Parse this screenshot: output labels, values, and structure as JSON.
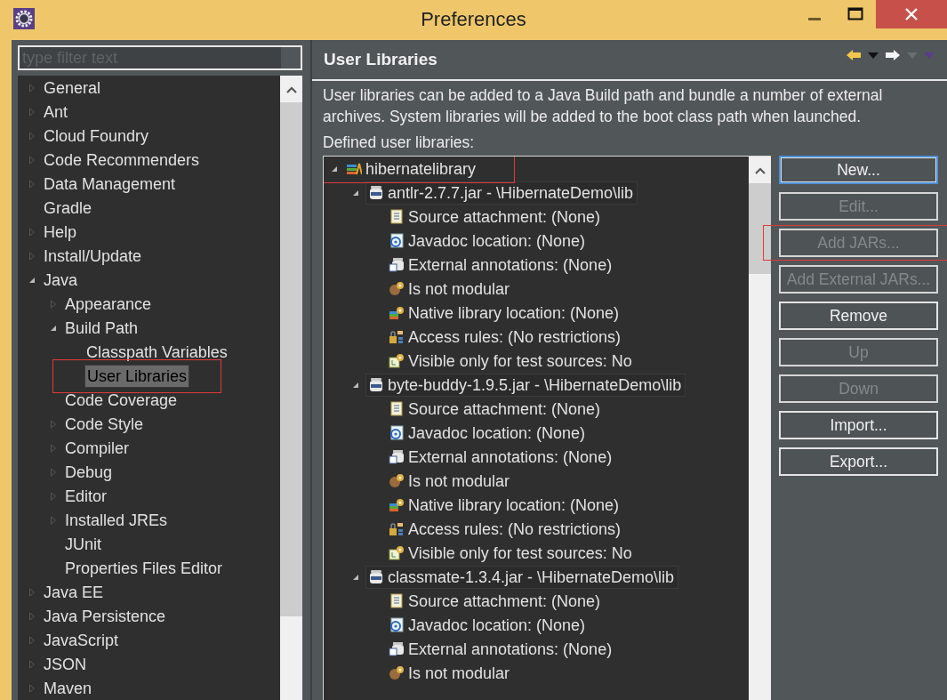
{
  "window": {
    "title": "Preferences"
  },
  "filter": {
    "placeholder": "type filter text"
  },
  "nav_tree": [
    {
      "label": "General",
      "expanded": false,
      "selected": false,
      "annotated": false
    },
    {
      "label": "Ant",
      "expanded": false,
      "selected": false,
      "annotated": false
    },
    {
      "label": "Cloud Foundry",
      "expanded": false,
      "selected": false,
      "annotated": false
    },
    {
      "label": "Code Recommenders",
      "expanded": false,
      "selected": false,
      "annotated": false
    },
    {
      "label": "Data Management",
      "expanded": false,
      "selected": false,
      "annotated": false
    },
    {
      "label": "Gradle",
      "selected": false,
      "annotated": false
    },
    {
      "label": "Help",
      "expanded": false,
      "selected": false,
      "annotated": false
    },
    {
      "label": "Install/Update",
      "expanded": false,
      "selected": false,
      "annotated": false
    },
    {
      "label": "Java",
      "expanded": true,
      "selected": false,
      "annotated": false,
      "children": [
        {
          "label": "Appearance",
          "expanded": false,
          "selected": false,
          "annotated": false
        },
        {
          "label": "Build Path",
          "expanded": true,
          "selected": false,
          "annotated": false,
          "children": [
            {
              "label": "Classpath Variables",
              "selected": false,
              "annotated": false
            },
            {
              "label": "User Libraries",
              "selected": true,
              "annotated": true
            }
          ]
        },
        {
          "label": "Code Coverage",
          "selected": false,
          "annotated": false
        },
        {
          "label": "Code Style",
          "expanded": false,
          "selected": false,
          "annotated": false
        },
        {
          "label": "Compiler",
          "expanded": false,
          "selected": false,
          "annotated": false
        },
        {
          "label": "Debug",
          "expanded": false,
          "selected": false,
          "annotated": false
        },
        {
          "label": "Editor",
          "expanded": false,
          "selected": false,
          "annotated": false
        },
        {
          "label": "Installed JREs",
          "expanded": false,
          "selected": false,
          "annotated": false
        },
        {
          "label": "JUnit",
          "selected": false,
          "annotated": false
        },
        {
          "label": "Properties Files Editor",
          "selected": false,
          "annotated": false
        }
      ]
    },
    {
      "label": "Java EE",
      "expanded": false,
      "selected": false,
      "annotated": false
    },
    {
      "label": "Java Persistence",
      "expanded": false,
      "selected": false,
      "annotated": false
    },
    {
      "label": "JavaScript",
      "expanded": false,
      "selected": false,
      "annotated": false
    },
    {
      "label": "JSON",
      "expanded": false,
      "selected": false,
      "annotated": false
    },
    {
      "label": "Maven",
      "expanded": false,
      "selected": false,
      "annotated": false
    }
  ],
  "page": {
    "title": "User Libraries",
    "description": "User libraries can be added to a Java Build path and bundle a number of external archives. System libraries will be added to the boot class path when launched.",
    "list_label": "Defined user libraries:"
  },
  "libraries": [
    {
      "label": "hibernatelibrary",
      "kind": "library",
      "expanded": true,
      "annotated": true,
      "children": [
        {
          "label": "antlr-2.7.7.jar - \\HibernateDemo\\lib",
          "kind": "jar",
          "expanded": true,
          "annotated": false,
          "children": [
            {
              "label": "Source attachment: (None)",
              "kind": "source",
              "annotated": false
            },
            {
              "label": "Javadoc location: (None)",
              "kind": "javadoc",
              "annotated": false
            },
            {
              "label": "External annotations: (None)",
              "kind": "annotations",
              "annotated": false
            },
            {
              "label": "Is not modular",
              "kind": "modular",
              "annotated": false
            },
            {
              "label": "Native library location: (None)",
              "kind": "native",
              "annotated": false
            },
            {
              "label": "Access rules: (No restrictions)",
              "kind": "access",
              "annotated": false
            },
            {
              "label": "Visible only for test sources: No",
              "kind": "test",
              "annotated": false
            }
          ]
        },
        {
          "label": "byte-buddy-1.9.5.jar - \\HibernateDemo\\lib",
          "kind": "jar",
          "expanded": true,
          "annotated": false,
          "children": [
            {
              "label": "Source attachment: (None)",
              "kind": "source",
              "annotated": false
            },
            {
              "label": "Javadoc location: (None)",
              "kind": "javadoc",
              "annotated": false
            },
            {
              "label": "External annotations: (None)",
              "kind": "annotations",
              "annotated": false
            },
            {
              "label": "Is not modular",
              "kind": "modular",
              "annotated": false
            },
            {
              "label": "Native library location: (None)",
              "kind": "native",
              "annotated": false
            },
            {
              "label": "Access rules: (No restrictions)",
              "kind": "access",
              "annotated": false
            },
            {
              "label": "Visible only for test sources: No",
              "kind": "test",
              "annotated": false
            }
          ]
        },
        {
          "label": "classmate-1.3.4.jar - \\HibernateDemo\\lib",
          "kind": "jar",
          "expanded": true,
          "annotated": false,
          "children": [
            {
              "label": "Source attachment: (None)",
              "kind": "source",
              "annotated": false
            },
            {
              "label": "Javadoc location: (None)",
              "kind": "javadoc",
              "annotated": false
            },
            {
              "label": "External annotations: (None)",
              "kind": "annotations",
              "annotated": false
            },
            {
              "label": "Is not modular",
              "kind": "modular",
              "annotated": false
            }
          ]
        }
      ]
    }
  ],
  "button_groups": [
    [
      {
        "label": "New...",
        "disabled": false,
        "focused": true,
        "annotated": false
      },
      {
        "label": "Edit...",
        "disabled": true,
        "focused": false,
        "annotated": false
      },
      {
        "label": "Add JARs...",
        "disabled": true,
        "focused": false,
        "annotated": true
      },
      {
        "label": "Add External JARs...",
        "disabled": true,
        "focused": false,
        "annotated": false
      },
      {
        "label": "Remove",
        "disabled": false,
        "focused": false,
        "annotated": false
      }
    ],
    [
      {
        "label": "Up",
        "disabled": true,
        "focused": false,
        "annotated": false
      },
      {
        "label": "Down",
        "disabled": true,
        "focused": false,
        "annotated": false
      }
    ],
    [
      {
        "label": "Import...",
        "disabled": false,
        "focused": false,
        "annotated": false
      },
      {
        "label": "Export...",
        "disabled": false,
        "focused": false,
        "annotated": false
      }
    ]
  ]
}
